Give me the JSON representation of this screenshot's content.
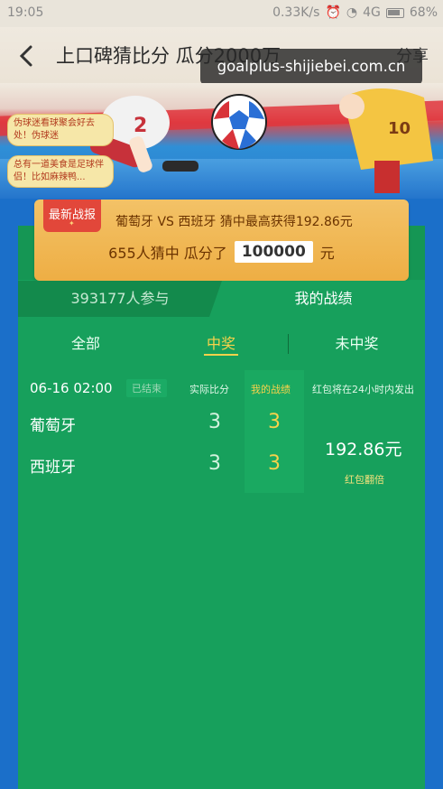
{
  "status_bar": {
    "time": "19:05",
    "network_speed": "0.33K/s",
    "network": "4G",
    "battery": "68%"
  },
  "title_bar": {
    "back_icon": "chevron-left-icon",
    "title": "上口碑猜比分 瓜分2000万",
    "share": "分享"
  },
  "watermark": "goalplus-shijiebei.com.cn",
  "banner": {
    "bubbles": [
      "伪球迷看球聚会好去处！伪球迷",
      "总有一道美食是足球伴侣！比如麻辣鸭..."
    ]
  },
  "report": {
    "badge": "最新战报",
    "headline": "葡萄牙 VS 西班牙   猜中最高获得192.86元",
    "prefix": "655人猜中 瓜分了",
    "prize": "100000",
    "unit": "元"
  },
  "tabs": {
    "participants": "393177人参与",
    "mine": "我的战绩"
  },
  "filters": {
    "all": "全部",
    "won": "中奖",
    "lost": "未中奖"
  },
  "result": {
    "time": "06-16 02:00",
    "status": "已结束",
    "header_actual": "实际比分",
    "header_mine": "我的战绩",
    "header_notice": "红包将在24小时内发出",
    "teams": [
      {
        "name": "葡萄牙",
        "actual": "3",
        "mine": "3"
      },
      {
        "name": "西班牙",
        "actual": "3",
        "mine": "3"
      }
    ],
    "amount": "192.86元",
    "double_link": "红包翻倍"
  },
  "colors": {
    "panel_green": "#17a05c",
    "accent_yellow": "#f7d24b",
    "report_orange": "#eeae44",
    "badge_red": "#e2473a"
  }
}
